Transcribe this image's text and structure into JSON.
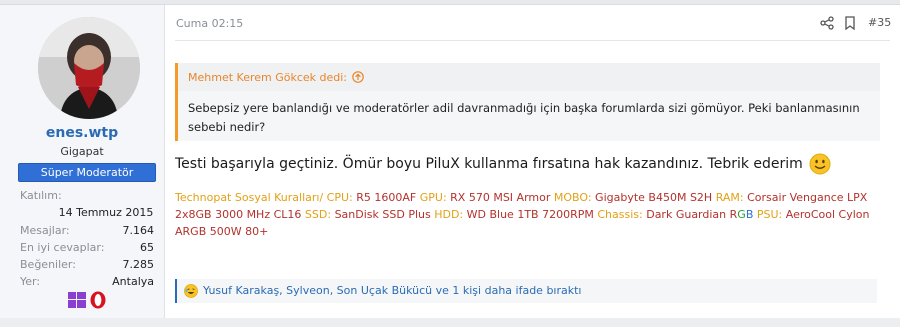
{
  "user": {
    "name": "enes.wtp",
    "title": "Gigapat",
    "role_banner": "Süper Moderatör",
    "stats": {
      "joined_label": "Katılım:",
      "joined_value": "14 Temmuz 2015",
      "messages_label": "Mesajlar:",
      "messages_value": "7.164",
      "best_answers_label": "En iyi cevaplar:",
      "best_answers_value": "65",
      "likes_label": "Beğeniler:",
      "likes_value": "7.285",
      "location_label": "Yer:",
      "location_value": "Antalya"
    },
    "icons": [
      "windows-icon",
      "opera-icon"
    ]
  },
  "post": {
    "date": "Cuma 02:15",
    "number": "#35",
    "actions": [
      "share-icon",
      "bookmark-icon"
    ],
    "quote": {
      "author": "Mehmet Kerem Gökcek dedi:",
      "text": "Sebepsiz yere banlandığı ve moderatörler adil davranmadığı için başka forumlarda sizi gömüyor. Peki banlanmasının sebebi nedir?"
    },
    "message": "Testi başarıyla geçtiniz. Ömür boyu PiluX kullanma fırsatına hak kazandınız. Tebrik ederim",
    "emoji": "slightly-smiling-face",
    "signature": {
      "rules_link": "Technopat Sosyal Kuralları",
      "separator": "/",
      "cpu_label": "CPU:",
      "cpu_value": "R5 1600AF",
      "gpu_label": "GPU:",
      "gpu_value": "RX 570 MSI Armor",
      "mobo_label": "MOBO:",
      "mobo_value": "Gigabyte B450M S2H",
      "ram_label": "RAM:",
      "ram_value": "Corsair Vengance LPX 2x8GB 3000 MHz CL16",
      "ssd_label": "SSD:",
      "ssd_value": "SanDisk SSD Plus",
      "hdd_label": "HDD:",
      "hdd_value": "WD Blue 1TB 7200RPM",
      "chassis_label": "Chassis:",
      "chassis_value": "Dark Guardian",
      "rgb_r": "R",
      "rgb_g": "G",
      "rgb_b": "B",
      "psu_label": "PSU:",
      "psu_value": "AeroCool Cylon ARGB 500W 80+"
    },
    "reactions": {
      "icon": "laughing-face-icon",
      "text": "Yusuf Karakaş, Sylveon, Son Uçak Bükücü ve 1 kişi daha ifade bıraktı"
    }
  },
  "colors": {
    "accent_blue": "#2a6bb3",
    "role_banner": "#2f6fd6",
    "quote_orange": "#e8862a",
    "sig_label_yellow": "#e2a116",
    "sig_value_red": "#b3322e"
  }
}
